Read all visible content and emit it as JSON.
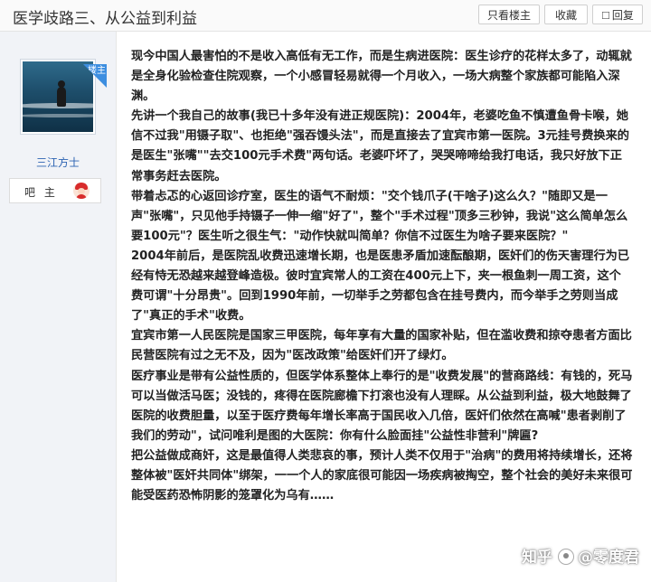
{
  "header": {
    "title": "医学歧路三、从公益到利益",
    "only_op_label": "只看楼主",
    "favorite_label": "收藏",
    "reply_label": "回复"
  },
  "user": {
    "badge": "楼主",
    "name": "三江方士",
    "role": "吧 主"
  },
  "post": {
    "paragraphs": [
      "现今中国人最害怕的不是收入高低有无工作，而是生病进医院：医生诊疗的花样太多了，动辄就是全身化验检查住院观察，一个小感冒轻易就得一个月收入，一场大病整个家族都可能陷入深渊。",
      "先讲一个我自己的故事(我已十多年没有进正规医院)：2004年，老婆吃鱼不慎遭鱼骨卡喉，她信不过我\"用镊子取\"、也拒绝\"强吞馒头法\"，而是直接去了宜宾市第一医院。3元挂号费换来的是医生\"张嘴\"\"去交100元手术费\"两句话。老婆吓坏了，哭哭啼啼给我打电话，我只好放下正常事务赶去医院。",
      "带着忐忑的心返回诊疗室，医生的语气不耐烦：\"交个钱爪子(干啥子)这么久？\"随即又是一声\"张嘴\"，只见他手持镊子一伸一缩\"好了\"，整个\"手术过程\"顶多三秒钟，我说\"这么简单怎么要100元\"？医生听之很生气：\"动作快就叫简单？你信不过医生为啥子要来医院？\"",
      "2004年前后，是医院乱收费迅速增长期，也是医患矛盾加速酝酿期，医奸们的伤天害理行为已经有恃无恐越来越登峰造极。彼时宜宾常人的工资在400元上下，夹一根鱼刺一周工资，这个费可谓\"十分昂贵\"。回到1990年前，一切举手之劳都包含在挂号费内，而今举手之劳则当成了\"真正的手术\"收费。",
      "宜宾市第一人民医院是国家三甲医院，每年享有大量的国家补贴，但在滥收费和掠夺患者方面比民营医院有过之无不及，因为\"医改政策\"给医奸们开了绿灯。",
      "医疗事业是带有公益性质的，但医学体系整体上奉行的是\"收费发展\"的营商路线：有钱的，死马可以当做活马医；没钱的，疼得在医院廊檐下打滚也没有人理睬。从公益到利益，极大地鼓舞了医院的收费胆量，以至于医疗费每年增长率高于国民收入几倍，医奸们依然在高喊\"患者剥削了我们的劳动\"，试问唯利是图的大医院：你有什么脸面挂\"公益性非营利\"牌匾?",
      "把公益做成商奸，这是最值得人类悲哀的事，预计人类不仅用于\"治病\"的费用将持续增长，还将整体被\"医奸共同体\"绑架，一一个人的家底很可能因一场疾病被掏空，整个社会的美好未来很可能受医药恐怖阴影的笼罩化为乌有……"
    ]
  },
  "watermark": {
    "site": "知乎",
    "author": "@零度君"
  },
  "colors": {
    "accent_blue": "#2d64b3",
    "badge_blue": "#3d8ee0"
  }
}
